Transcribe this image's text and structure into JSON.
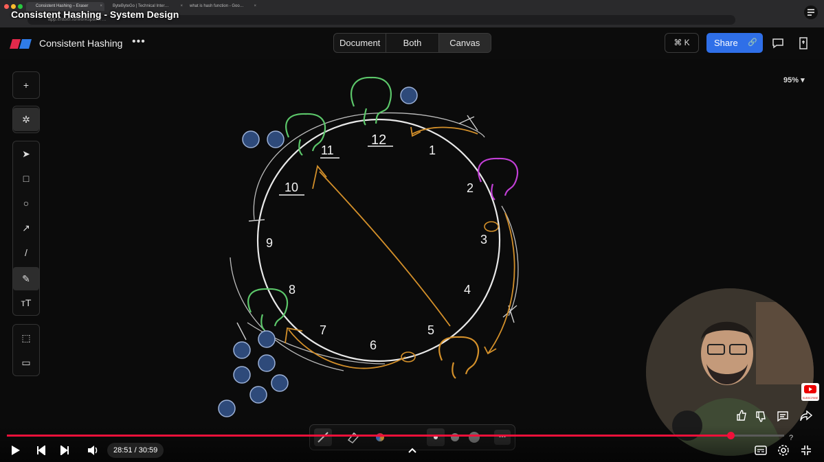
{
  "browser": {
    "tabs": [
      "Consistent Hashing – Eraser",
      "ByteByteGo | Technical Inter…",
      "what is hash function - Goo…"
    ],
    "url": "app.eraser.io/workspace/…"
  },
  "video_title": "Consistent Hashing - System Design",
  "app": {
    "doc_title": "Consistent Hashing",
    "more_label": "•••",
    "view_tabs": [
      "Document",
      "Both",
      "Canvas"
    ],
    "active_view": "Canvas",
    "command_shortcut": "⌘ K",
    "share_label": "Share",
    "zoom_level": "95%",
    "accent_color": "#2f6fe8"
  },
  "toolbar": {
    "items": [
      {
        "name": "add-button",
        "glyph": "+"
      },
      {
        "name": "ai-magic-button",
        "glyph": "✲"
      },
      {
        "name": "select-tool",
        "glyph": "➤"
      },
      {
        "name": "rectangle-tool",
        "glyph": "□"
      },
      {
        "name": "ellipse-tool",
        "glyph": "○"
      },
      {
        "name": "arrow-tool",
        "glyph": "↗"
      },
      {
        "name": "line-tool",
        "glyph": "/"
      },
      {
        "name": "pencil-tool",
        "glyph": "✎"
      },
      {
        "name": "text-tool",
        "glyph": "ᴛT"
      },
      {
        "name": "frame-tool",
        "glyph": "⬚"
      },
      {
        "name": "comment-tool",
        "glyph": "▭"
      }
    ]
  },
  "whiteboard": {
    "clock_numbers": [
      "12",
      "1",
      "2",
      "3",
      "4",
      "5",
      "6",
      "7",
      "8",
      "9",
      "10",
      "11"
    ],
    "colors": {
      "green": "#5cc76a",
      "magenta": "#c23fd6",
      "orange": "#d4902a",
      "key_blue": "#2e4a7a"
    }
  },
  "player": {
    "current_time": "28:51",
    "duration": "30:59",
    "progress_fraction": 0.931,
    "play_color": "#f0103a"
  },
  "channel_badge": "SUBSCRIBE"
}
